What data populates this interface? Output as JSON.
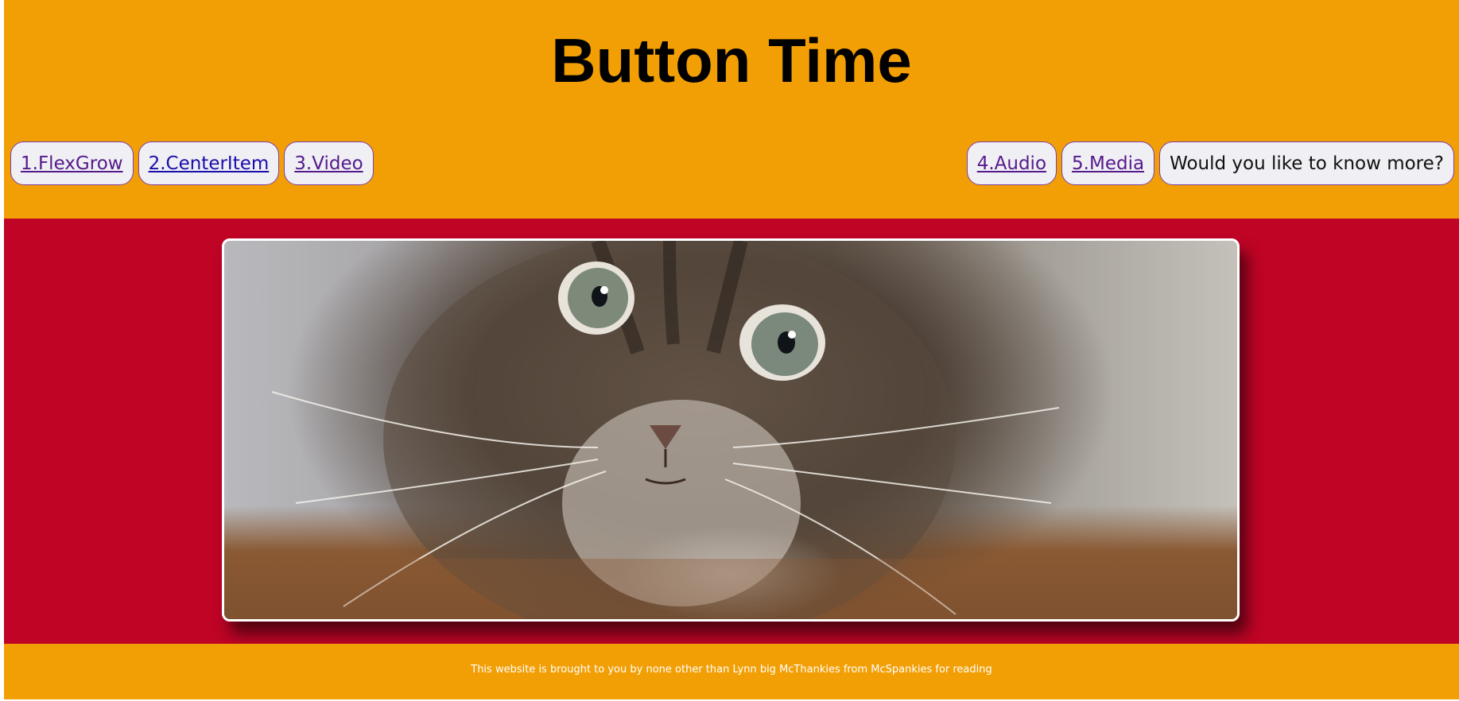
{
  "header": {
    "title": "Button Time",
    "background_color": "#f29f05"
  },
  "nav": {
    "left": [
      {
        "label": "1.FlexGrow"
      },
      {
        "label": "2.CenterItem"
      },
      {
        "label": "3.Video"
      }
    ],
    "right": [
      {
        "label": "4.Audio"
      },
      {
        "label": "5.Media"
      },
      {
        "label": "Would you like to know more?"
      }
    ]
  },
  "main": {
    "background_color": "#bf0426",
    "image": {
      "subject": "kitten photo"
    }
  },
  "footer": {
    "text": "This website is brought to you by none other than Lynn big McThankies from McSpankies for reading",
    "background_color": "#f29f05"
  }
}
